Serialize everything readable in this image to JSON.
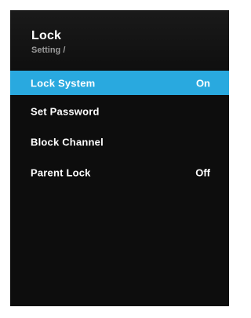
{
  "header": {
    "title": "Lock",
    "breadcrumb": "Setting /"
  },
  "menu": {
    "items": [
      {
        "label": "Lock System",
        "value": "On",
        "selected": true
      },
      {
        "label": "Set Password",
        "value": ""
      },
      {
        "label": "Block Channel",
        "value": ""
      },
      {
        "label": "Parent Lock",
        "value": "Off"
      }
    ]
  },
  "colors": {
    "highlight": "#29a9df",
    "panel_background": "#0d0d0d",
    "header_background": "#1a1a1a",
    "breadcrumb_text": "#9a9a9a"
  }
}
